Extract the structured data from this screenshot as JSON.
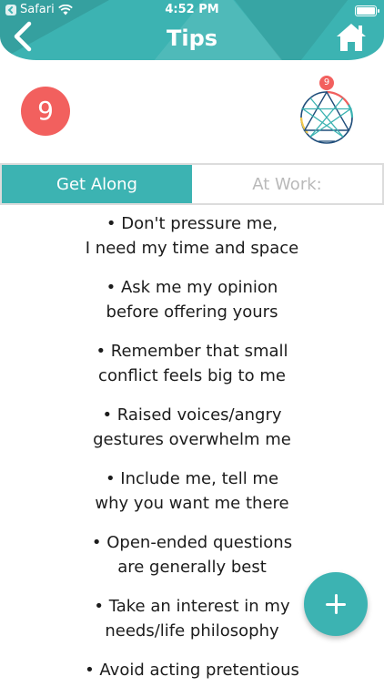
{
  "status_bar": {
    "carrier": "Safari",
    "time": "4:52 PM"
  },
  "header": {
    "title": "Tips"
  },
  "type_number": "9",
  "ennea_badge": "9",
  "tabs": [
    {
      "label": "Get Along",
      "active": true
    },
    {
      "label": "At Work:",
      "active": false
    }
  ],
  "tips": [
    {
      "line1": "• Don't pressure me,",
      "line2": "I need my time and space"
    },
    {
      "line1": "• Ask me my opinion",
      "line2": "before offering yours"
    },
    {
      "line1": "• Remember that small",
      "line2": "conflict feels big to me"
    },
    {
      "line1": "• Raised voices/angry",
      "line2": "gestures overwhelm me"
    },
    {
      "line1": "• Include me, tell me",
      "line2": "why you want me there"
    },
    {
      "line1": "• Open-ended questions",
      "line2": "are generally best"
    },
    {
      "line1": "• Take an interest in my",
      "line2": "needs/life philosophy"
    },
    {
      "line1": "• Avoid acting pretentious",
      "line2": ""
    }
  ],
  "colors": {
    "accent": "#3cb3b2",
    "badge": "#f2605e"
  },
  "icons": {
    "back": "chevron-left-icon",
    "home": "home-icon",
    "add": "plus-icon",
    "wifi": "wifi-icon",
    "battery": "battery-icon"
  }
}
